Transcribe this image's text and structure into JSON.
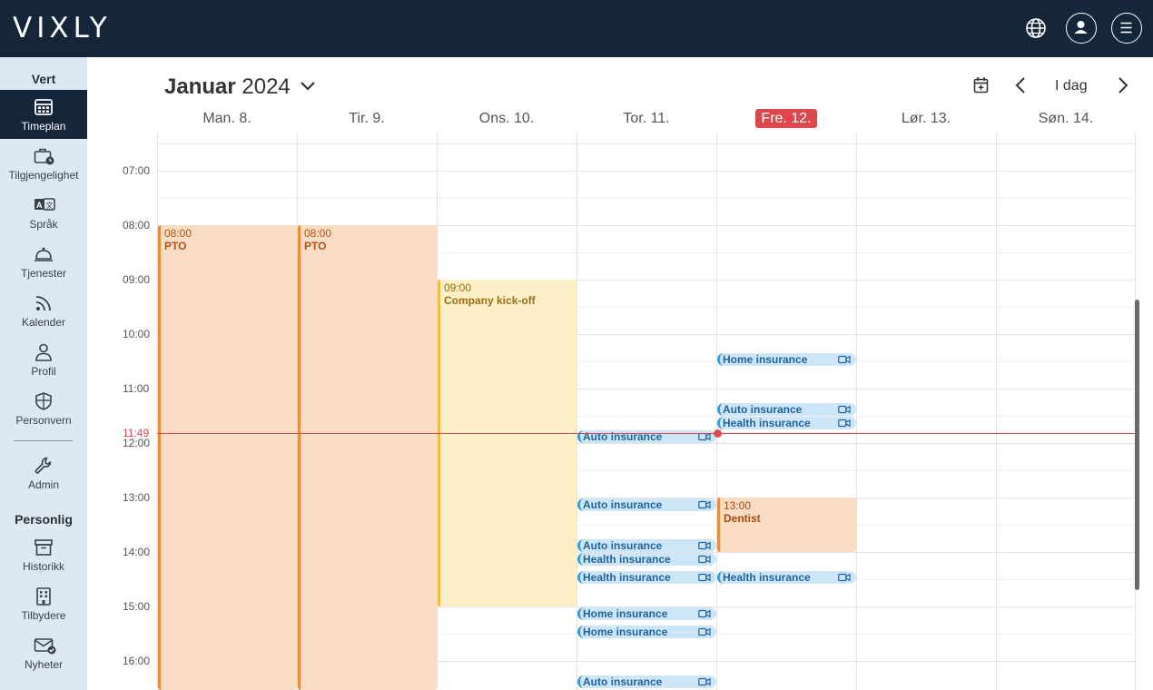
{
  "app": {
    "logo": "VIXLY"
  },
  "sidebar": {
    "section_host": "Vert",
    "section_personal": "Personlig",
    "items": [
      {
        "label": "Timeplan",
        "icon": "calendar-grid-icon",
        "active": true
      },
      {
        "label": "Tilgjengelighet",
        "icon": "briefcase-clock-icon"
      },
      {
        "label": "Språk",
        "icon": "translate-icon"
      },
      {
        "label": "Tjenester",
        "icon": "service-bell-icon"
      },
      {
        "label": "Kalender",
        "icon": "rss-feed-icon"
      },
      {
        "label": "Profil",
        "icon": "person-icon"
      },
      {
        "label": "Personvern",
        "icon": "shield-icon"
      },
      {
        "label": "Admin",
        "icon": "wrench-icon"
      },
      {
        "label": "Historikk",
        "icon": "archive-box-icon"
      },
      {
        "label": "Tilbydere",
        "icon": "building-icon"
      },
      {
        "label": "Nyheter",
        "icon": "mail-check-icon"
      }
    ]
  },
  "calendar": {
    "month": "Januar",
    "year": "2024",
    "today_button": "I dag",
    "days": [
      "Man. 8.",
      "Tir. 9.",
      "Ons. 10.",
      "Tor. 11.",
      "Fre. 12.",
      "Lør. 13.",
      "Søn. 14."
    ],
    "hours": [
      "07:00",
      "08:00",
      "09:00",
      "10:00",
      "11:00",
      "12:00",
      "13:00",
      "14:00",
      "15:00",
      "16:00"
    ],
    "now": "11:49",
    "events": [
      {
        "time": "08:00",
        "title": "PTO"
      },
      {
        "time": "08:00",
        "title": "PTO"
      },
      {
        "time": "09:00",
        "title": "Company kick-off"
      },
      {
        "time": "13:00",
        "title": "Dentist"
      }
    ],
    "pills": [
      "Home insurance",
      "Auto insurance",
      "Health insurance",
      "Auto insurance",
      "Auto insurance",
      "Auto insurance",
      "Health insurance",
      "Health insurance",
      "Health insurance",
      "Home insurance",
      "Home insurance",
      "Auto insurance"
    ]
  }
}
